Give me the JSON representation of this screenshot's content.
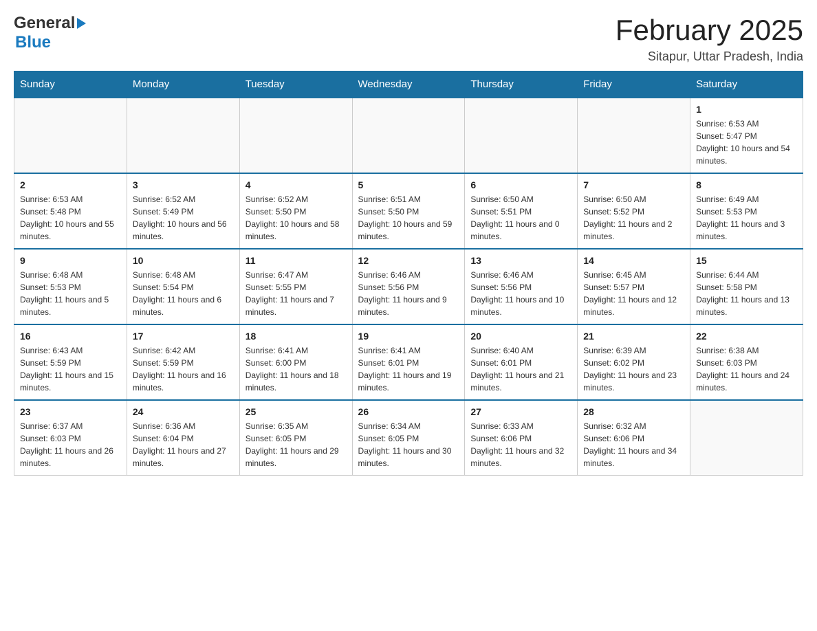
{
  "header": {
    "logo_general": "General",
    "logo_blue": "Blue",
    "month_title": "February 2025",
    "location": "Sitapur, Uttar Pradesh, India"
  },
  "days_of_week": [
    "Sunday",
    "Monday",
    "Tuesday",
    "Wednesday",
    "Thursday",
    "Friday",
    "Saturday"
  ],
  "weeks": [
    [
      {
        "day": "",
        "info": ""
      },
      {
        "day": "",
        "info": ""
      },
      {
        "day": "",
        "info": ""
      },
      {
        "day": "",
        "info": ""
      },
      {
        "day": "",
        "info": ""
      },
      {
        "day": "",
        "info": ""
      },
      {
        "day": "1",
        "info": "Sunrise: 6:53 AM\nSunset: 5:47 PM\nDaylight: 10 hours and 54 minutes."
      }
    ],
    [
      {
        "day": "2",
        "info": "Sunrise: 6:53 AM\nSunset: 5:48 PM\nDaylight: 10 hours and 55 minutes."
      },
      {
        "day": "3",
        "info": "Sunrise: 6:52 AM\nSunset: 5:49 PM\nDaylight: 10 hours and 56 minutes."
      },
      {
        "day": "4",
        "info": "Sunrise: 6:52 AM\nSunset: 5:50 PM\nDaylight: 10 hours and 58 minutes."
      },
      {
        "day": "5",
        "info": "Sunrise: 6:51 AM\nSunset: 5:50 PM\nDaylight: 10 hours and 59 minutes."
      },
      {
        "day": "6",
        "info": "Sunrise: 6:50 AM\nSunset: 5:51 PM\nDaylight: 11 hours and 0 minutes."
      },
      {
        "day": "7",
        "info": "Sunrise: 6:50 AM\nSunset: 5:52 PM\nDaylight: 11 hours and 2 minutes."
      },
      {
        "day": "8",
        "info": "Sunrise: 6:49 AM\nSunset: 5:53 PM\nDaylight: 11 hours and 3 minutes."
      }
    ],
    [
      {
        "day": "9",
        "info": "Sunrise: 6:48 AM\nSunset: 5:53 PM\nDaylight: 11 hours and 5 minutes."
      },
      {
        "day": "10",
        "info": "Sunrise: 6:48 AM\nSunset: 5:54 PM\nDaylight: 11 hours and 6 minutes."
      },
      {
        "day": "11",
        "info": "Sunrise: 6:47 AM\nSunset: 5:55 PM\nDaylight: 11 hours and 7 minutes."
      },
      {
        "day": "12",
        "info": "Sunrise: 6:46 AM\nSunset: 5:56 PM\nDaylight: 11 hours and 9 minutes."
      },
      {
        "day": "13",
        "info": "Sunrise: 6:46 AM\nSunset: 5:56 PM\nDaylight: 11 hours and 10 minutes."
      },
      {
        "day": "14",
        "info": "Sunrise: 6:45 AM\nSunset: 5:57 PM\nDaylight: 11 hours and 12 minutes."
      },
      {
        "day": "15",
        "info": "Sunrise: 6:44 AM\nSunset: 5:58 PM\nDaylight: 11 hours and 13 minutes."
      }
    ],
    [
      {
        "day": "16",
        "info": "Sunrise: 6:43 AM\nSunset: 5:59 PM\nDaylight: 11 hours and 15 minutes."
      },
      {
        "day": "17",
        "info": "Sunrise: 6:42 AM\nSunset: 5:59 PM\nDaylight: 11 hours and 16 minutes."
      },
      {
        "day": "18",
        "info": "Sunrise: 6:41 AM\nSunset: 6:00 PM\nDaylight: 11 hours and 18 minutes."
      },
      {
        "day": "19",
        "info": "Sunrise: 6:41 AM\nSunset: 6:01 PM\nDaylight: 11 hours and 19 minutes."
      },
      {
        "day": "20",
        "info": "Sunrise: 6:40 AM\nSunset: 6:01 PM\nDaylight: 11 hours and 21 minutes."
      },
      {
        "day": "21",
        "info": "Sunrise: 6:39 AM\nSunset: 6:02 PM\nDaylight: 11 hours and 23 minutes."
      },
      {
        "day": "22",
        "info": "Sunrise: 6:38 AM\nSunset: 6:03 PM\nDaylight: 11 hours and 24 minutes."
      }
    ],
    [
      {
        "day": "23",
        "info": "Sunrise: 6:37 AM\nSunset: 6:03 PM\nDaylight: 11 hours and 26 minutes."
      },
      {
        "day": "24",
        "info": "Sunrise: 6:36 AM\nSunset: 6:04 PM\nDaylight: 11 hours and 27 minutes."
      },
      {
        "day": "25",
        "info": "Sunrise: 6:35 AM\nSunset: 6:05 PM\nDaylight: 11 hours and 29 minutes."
      },
      {
        "day": "26",
        "info": "Sunrise: 6:34 AM\nSunset: 6:05 PM\nDaylight: 11 hours and 30 minutes."
      },
      {
        "day": "27",
        "info": "Sunrise: 6:33 AM\nSunset: 6:06 PM\nDaylight: 11 hours and 32 minutes."
      },
      {
        "day": "28",
        "info": "Sunrise: 6:32 AM\nSunset: 6:06 PM\nDaylight: 11 hours and 34 minutes."
      },
      {
        "day": "",
        "info": ""
      }
    ]
  ]
}
